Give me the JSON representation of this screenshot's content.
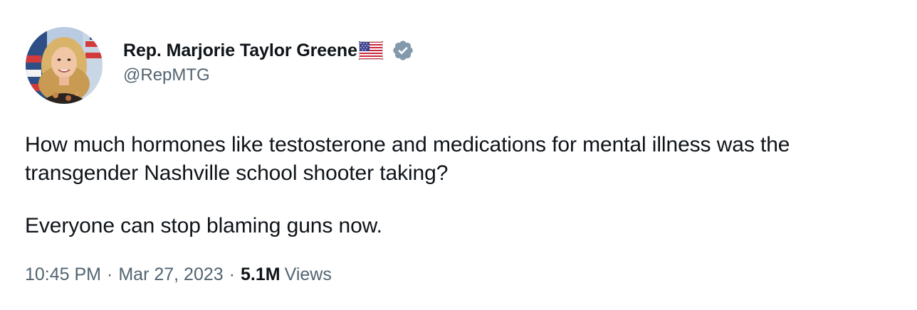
{
  "author": {
    "display_name": "Rep. Marjorie Taylor Greene",
    "handle": "@RepMTG",
    "flag_icon": "us-flag-icon",
    "verified_icon": "verified-badge-icon",
    "verified_color": "#829aab"
  },
  "tweet": {
    "paragraph1": "How much hormones like testosterone and medications for mental illness was the transgender Nashville school shooter taking?",
    "paragraph2": "Everyone can stop blaming guns now."
  },
  "meta": {
    "time": "10:45 PM",
    "separator": "·",
    "date": "Mar 27, 2023",
    "views_count": "5.1M",
    "views_label": "Views"
  },
  "colors": {
    "text_primary": "#0f1419",
    "text_secondary": "#536471",
    "background": "#ffffff"
  }
}
